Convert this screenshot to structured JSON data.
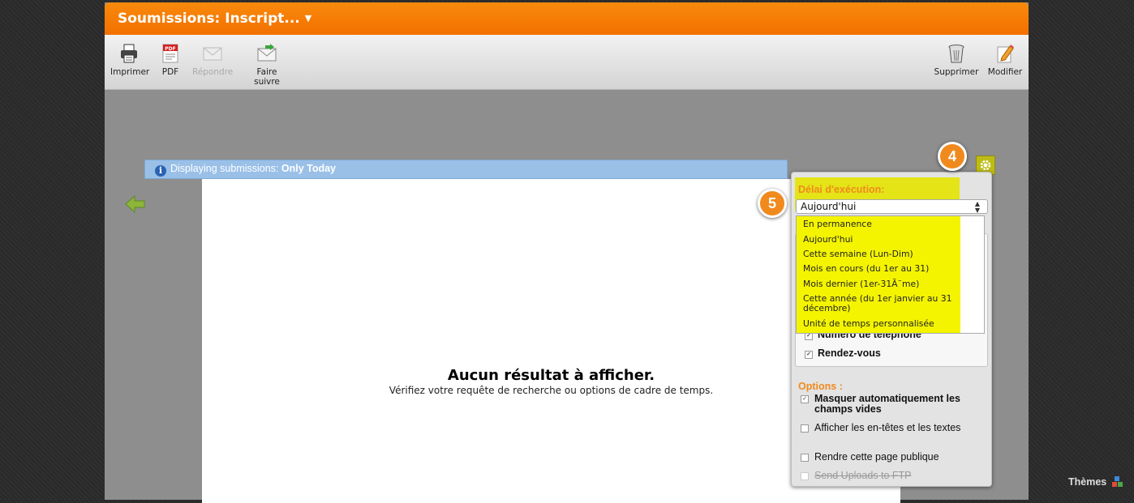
{
  "window": {
    "title": "Soumissions: Inscript..."
  },
  "toolbar": {
    "print": "Imprimer",
    "pdf": "PDF",
    "reply": "Répondre",
    "forward": "Faire suivre",
    "delete": "Supprimer",
    "edit": "Modifier"
  },
  "banner": {
    "prefix": "Displaying submissions:",
    "value": "Only Today"
  },
  "empty": {
    "heading": "Aucun résultat à afficher.",
    "hint": "Vérifiez votre requête de recherche ou options de cadre de temps."
  },
  "settings": {
    "timeframe_label": "Délai d'exécution:",
    "timeframe_value": "Aujourd'hui",
    "timeframe_options": [
      "En permanence",
      "Aujourd'hui",
      "Cette semaine (Lun-Dim)",
      "Mois en cours (du 1er au 31)",
      "Mois dernier (1er-31Ã¨me)",
      "Cette année (du 1er janvier au 31 décembre)",
      "Unité de temps personnalisée"
    ],
    "columns": [
      {
        "label": "Numéro de téléphone",
        "checked": true
      },
      {
        "label": "Rendez-vous",
        "checked": true
      }
    ],
    "options_label": "Options :",
    "options": [
      {
        "label": "Masquer automatiquement les champs vides",
        "checked": true
      },
      {
        "label": "Afficher les en-têtes et les textes",
        "checked": false
      },
      {
        "label": "Rendre cette page publique",
        "checked": false
      },
      {
        "label": "Send Uploads to FTP",
        "checked": false
      }
    ]
  },
  "badges": {
    "gear_step": "4",
    "select_step": "5"
  },
  "footer": {
    "themes": "Thèmes"
  },
  "colors": {
    "accent_orange": "#f27000",
    "highlight_yellow": "#f4f400",
    "banner_blue": "#9ac0e8"
  }
}
